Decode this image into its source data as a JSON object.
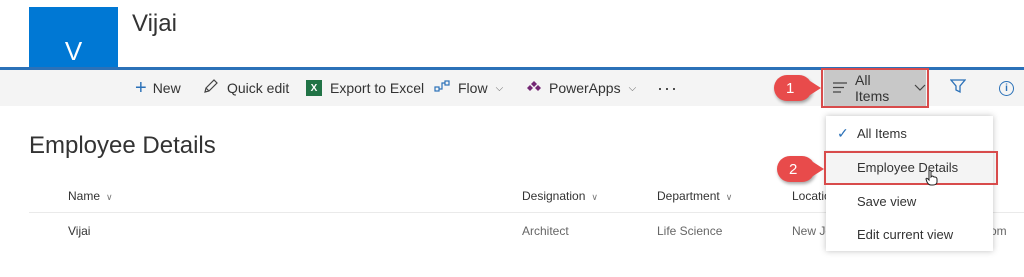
{
  "site": {
    "logo_letter": "V",
    "title": "Vijai"
  },
  "command_bar": {
    "new_label": "New",
    "quick_edit_label": "Quick edit",
    "export_label": "Export to Excel",
    "excel_icon_letter": "X",
    "flow_label": "Flow",
    "powerapps_label": "PowerApps",
    "more_label": "···",
    "view_selector_label": "All Items"
  },
  "annotations": {
    "step1": "1",
    "step2": "2",
    "color": "#e84b4b"
  },
  "list": {
    "title": "Employee Details",
    "columns": [
      "Name",
      "Designation",
      "Department",
      "Location"
    ],
    "rows": [
      {
        "name": "Vijai",
        "designation": "Architect",
        "department": "Life Science",
        "location": "New Je",
        "email_fragment": "om"
      }
    ]
  },
  "view_menu": {
    "items": [
      {
        "label": "All Items",
        "checked": true
      },
      {
        "label": "Employee Details",
        "checked": false,
        "hovered": true
      },
      {
        "label": "Save view"
      },
      {
        "label": "Edit current view"
      }
    ]
  },
  "colors": {
    "accent": "#2b71b8",
    "logo_bg": "#0078d4",
    "excel": "#217346",
    "highlight": "#d84b4b"
  }
}
